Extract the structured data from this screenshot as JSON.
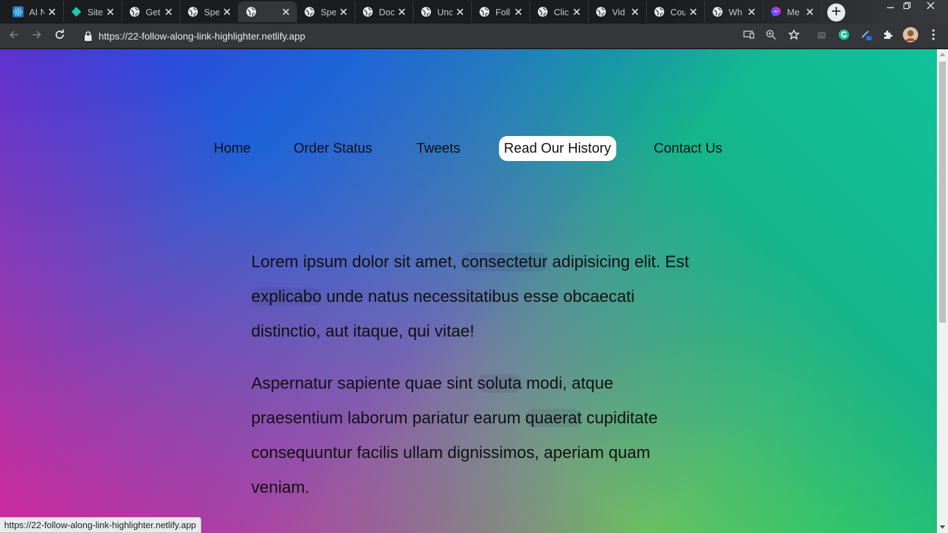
{
  "browser": {
    "tabs": [
      {
        "title": "AI N",
        "icon": "react-icon"
      },
      {
        "title": "Site",
        "icon": "netlify-icon"
      },
      {
        "title": "Get",
        "icon": "globe-icon"
      },
      {
        "title": "Spe",
        "icon": "globe-icon"
      },
      {
        "title": "",
        "icon": "globe-icon",
        "active": true
      },
      {
        "title": "Spe",
        "icon": "globe-icon"
      },
      {
        "title": "Doc",
        "icon": "globe-icon"
      },
      {
        "title": "Unc",
        "icon": "globe-icon"
      },
      {
        "title": "Foll",
        "icon": "globe-icon"
      },
      {
        "title": "Clic",
        "icon": "globe-icon"
      },
      {
        "title": "Vid",
        "icon": "globe-icon"
      },
      {
        "title": "Cou",
        "icon": "globe-icon"
      },
      {
        "title": "Wh",
        "icon": "globe-icon"
      },
      {
        "title": "Me",
        "icon": "messenger-icon"
      }
    ],
    "url": "https://22-follow-along-link-highlighter.netlify.app",
    "status_url": "https://22-follow-along-link-highlighter.netlify.app"
  },
  "page": {
    "menu": [
      {
        "label": "Home"
      },
      {
        "label": "Order Status"
      },
      {
        "label": "Tweets"
      },
      {
        "label": "Read Our History",
        "highlighted": true
      },
      {
        "label": "Contact Us"
      }
    ],
    "paragraph1": {
      "a": "Lorem ipsum dolor sit amet, ",
      "link1": "consectetur",
      "b": " adipisicing elit. Est ",
      "link2": "explicabo",
      "c": " unde natus necessitatibus esse obcaecati distinctio, aut itaque, qui vitae!"
    },
    "paragraph2": {
      "a": "Aspernatur sapiente quae sint ",
      "link1": "soluta",
      "b": " modi, atque praesentium laborum pariatur earum ",
      "link2": "quaerat",
      "c": " cupiditate consequuntur facilis ullam dignissimos, aperiam quam veniam."
    }
  },
  "colors": {
    "gradient_top_left": "#3a34e0",
    "gradient_top_right": "#0fc29a",
    "gradient_bottom_left": "#d0289a",
    "gradient_bottom_right": "#3ddc4a",
    "highlight": "#ffffff"
  }
}
